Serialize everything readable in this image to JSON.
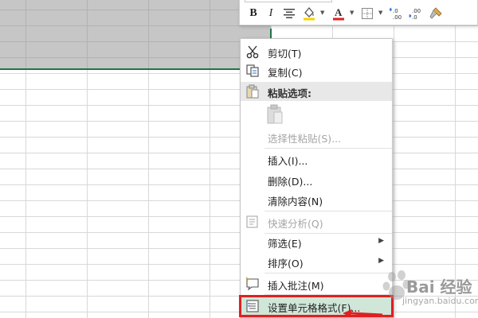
{
  "colors": {
    "selection_fill": "#c6c6c6",
    "selection_border": "#217346",
    "font_color_underline": "#e02020",
    "fill_color_underline": "#f5d400",
    "highlight_fill": "#cfe6d8",
    "highlight_outline": "#e02020"
  },
  "mini_toolbar": {
    "bold": "B",
    "italic": "I",
    "font_color_letter": "A",
    "increase_decimal_label": ".0",
    "decrease_decimal_label": ".00",
    "icons": [
      "align-center-icon",
      "fill-color-icon",
      "font-color-icon",
      "borders-icon",
      "increase-decimal-icon",
      "decrease-decimal-icon",
      "format-painter-icon"
    ]
  },
  "context_menu": {
    "cut": "剪切(T)",
    "copy": "复制(C)",
    "paste_options": "粘贴选项:",
    "paste_special": "选择性粘贴(S)...",
    "insert": "插入(I)...",
    "delete": "删除(D)...",
    "clear_contents": "清除内容(N)",
    "quick_analysis": "快速分析(Q)",
    "filter": "筛选(E)",
    "sort": "排序(O)",
    "insert_comment": "插入批注(M)",
    "format_cells": "设置单元格格式(F)..."
  },
  "watermark": {
    "text": "Bai 经验",
    "sub": "jingyan.baidu.com"
  }
}
